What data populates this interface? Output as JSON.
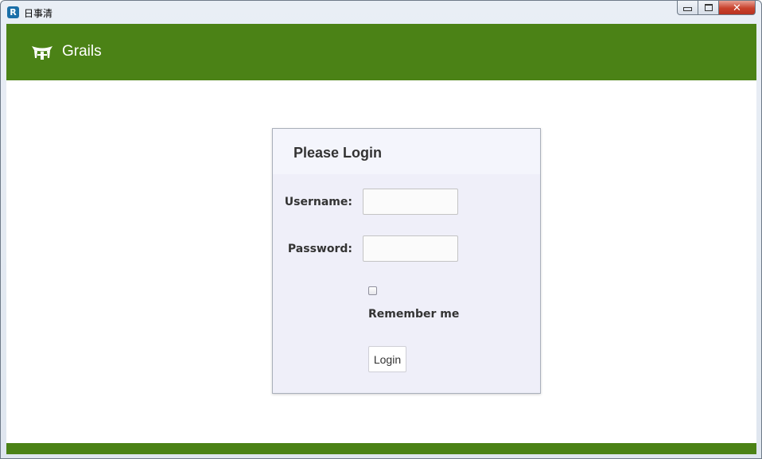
{
  "window": {
    "title": "日事清",
    "app_icon": "R",
    "minimize_label": "",
    "maximize_label": "",
    "close_label": "✕"
  },
  "header": {
    "brand_name": "Grails",
    "brand_icon": "grails-logo-icon",
    "background_color": "#4b8216"
  },
  "login": {
    "title": "Please Login",
    "username_label": "Username:",
    "username_value": "",
    "password_label": "Password:",
    "password_value": "",
    "remember_label": "Remember me",
    "remember_checked": false,
    "submit_label": "Login"
  },
  "footer": {
    "background_color": "#4b8216"
  }
}
